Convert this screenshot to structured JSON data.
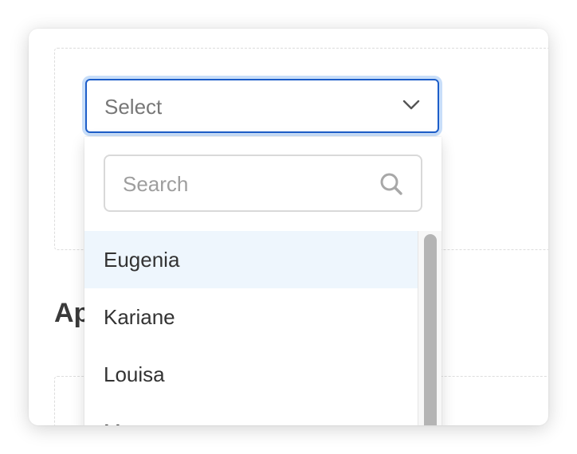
{
  "section": {
    "title": "Ap"
  },
  "select": {
    "value": "Select"
  },
  "dropdown": {
    "search_placeholder": "Search",
    "options": [
      {
        "label": "Eugenia",
        "highlighted": true
      },
      {
        "label": "Kariane",
        "highlighted": false
      },
      {
        "label": "Louisa",
        "highlighted": false
      },
      {
        "label": "Marty",
        "highlighted": false
      }
    ]
  },
  "colors": {
    "accent": "#1d5ec9",
    "focus_ring": "#c8def9",
    "highlight_bg": "#eef6fd"
  },
  "icons": {
    "chevron": "chevron-down-icon",
    "search": "search-icon"
  }
}
